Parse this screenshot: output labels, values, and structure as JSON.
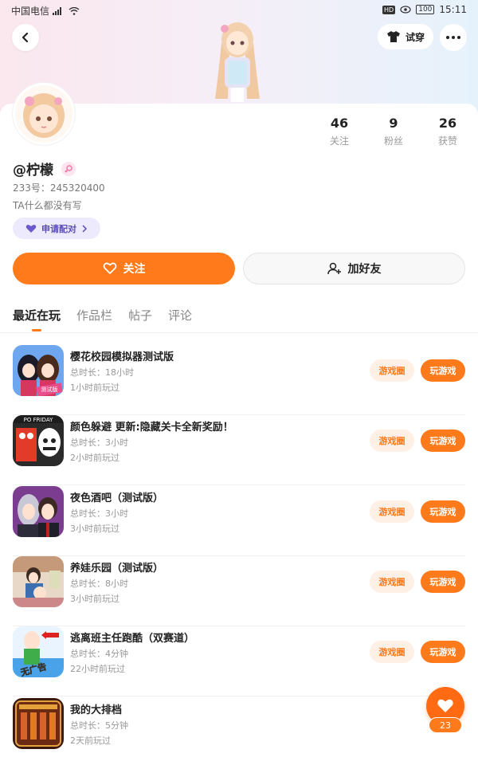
{
  "status_bar": {
    "carrier": "中国电信",
    "time": "15:11",
    "battery": "100",
    "hd": "HD"
  },
  "header": {
    "try_on_label": "试穿"
  },
  "profile": {
    "username": "@柠檬",
    "uid": "233号：245320400",
    "bio": "TA什么都没有写",
    "match_label": "申请配对",
    "stats": [
      {
        "value": "46",
        "label": "关注"
      },
      {
        "value": "9",
        "label": "粉丝"
      },
      {
        "value": "26",
        "label": "获赞"
      }
    ]
  },
  "actions": {
    "follow_label": "关注",
    "add_friend_label": "加好友"
  },
  "tabs": [
    {
      "label": "最近在玩",
      "active": true
    },
    {
      "label": "作品栏",
      "active": false
    },
    {
      "label": "帖子",
      "active": false
    },
    {
      "label": "评论",
      "active": false
    }
  ],
  "games": [
    {
      "title": "樱花校园模拟器测试版",
      "duration": "总时长：18小时",
      "last_played": "1小时前玩过",
      "circle_label": "游戏圈",
      "play_label": "玩游戏"
    },
    {
      "title": "颜色躲避 更新:隐藏关卡全新奖励！",
      "duration": "总时长：3小时",
      "last_played": "2小时前玩过",
      "circle_label": "游戏圈",
      "play_label": "玩游戏"
    },
    {
      "title": "夜色酒吧（测试版）",
      "duration": "总时长：3小时",
      "last_played": "3小时前玩过",
      "circle_label": "游戏圈",
      "play_label": "玩游戏"
    },
    {
      "title": "养娃乐园（测试版）",
      "duration": "总时长：8小时",
      "last_played": "3小时前玩过",
      "circle_label": "游戏圈",
      "play_label": "玩游戏"
    },
    {
      "title": "逃离班主任跑酷（双赛道）",
      "duration": "总时长：4分钟",
      "last_played": "22小时前玩过",
      "circle_label": "游戏圈",
      "play_label": "玩游戏"
    },
    {
      "title": "我的大排档",
      "duration": "总时长：5分钟",
      "last_played": "2天前玩过",
      "circle_label": "",
      "play_label": ""
    }
  ],
  "fab": {
    "count": "23"
  },
  "icons": {
    "back": "back-arrow-icon",
    "shirt": "shirt-icon",
    "more": "more-dots-icon",
    "gender": "female-gender-icon",
    "heart": "heart-icon",
    "add_user": "add-user-icon"
  },
  "colors": {
    "accent": "#ff7a1a",
    "match_bg": "#eeeafd",
    "match_text": "#5a4db8"
  },
  "game_icon_art": {
    "sakura_badge": "测试版",
    "color_dodge_banner": "PO FRIDAY",
    "escape_badge": "无广告"
  }
}
